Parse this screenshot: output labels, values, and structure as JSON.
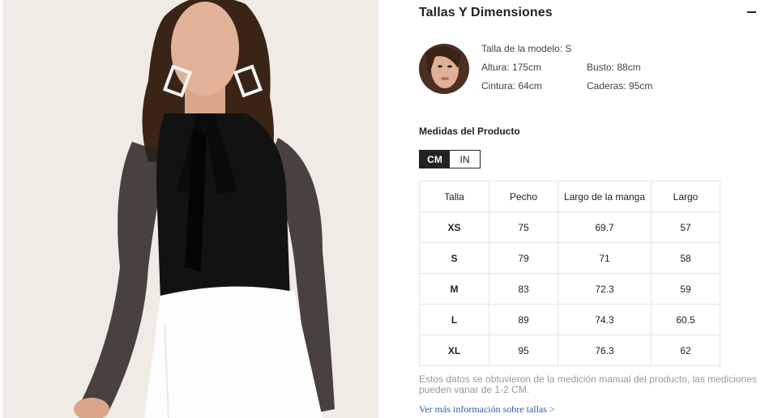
{
  "section": {
    "title": "Tallas Y Dimensiones",
    "collapse_icon": "minus-icon"
  },
  "model": {
    "size": "Talla de la modelo: S",
    "height": "Altura: 175cm",
    "bust": "Busto: 88cm",
    "waist": "Cintura: 64cm",
    "hips": "Caderas: 95cm"
  },
  "measures": {
    "title": "Medidas del Producto",
    "units": [
      "CM",
      "IN"
    ],
    "selected_unit": "CM"
  },
  "table": {
    "headers": [
      "Talla",
      "Pecho",
      "Largo de la manga",
      "Largo"
    ],
    "rows": [
      [
        "XS",
        "75",
        "69.7",
        "57"
      ],
      [
        "S",
        "79",
        "71",
        "58"
      ],
      [
        "M",
        "83",
        "72.3",
        "59"
      ],
      [
        "L",
        "89",
        "74.3",
        "60.5"
      ],
      [
        "XL",
        "95",
        "76.3",
        "62"
      ]
    ]
  },
  "note": "Estos datos se obtuvieron de la medición manual del producto, las mediciones pueden variar de 1-2 CM.",
  "more_link": "Ver más información sobre tallas >",
  "colors": {
    "accent_dark": "#222222",
    "link": "#2a5db0",
    "muted_text": "#999999",
    "table_border": "#e5e5e5"
  }
}
